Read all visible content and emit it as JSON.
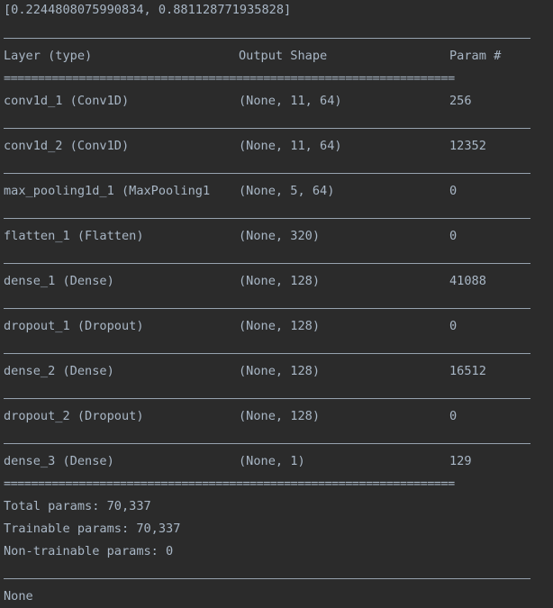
{
  "result_line": "[0.2244808075990834, 0.881128771935828]",
  "summary": {
    "headers": {
      "layer": "Layer (type)",
      "output_shape": "Output Shape",
      "param": "Param #"
    },
    "double_rule": "==================================================================",
    "rows": [
      {
        "layer": "conv1d_1 (Conv1D)",
        "shape": "(None, 11, 64)",
        "param": "256"
      },
      {
        "layer": "conv1d_2 (Conv1D)",
        "shape": "(None, 11, 64)",
        "param": "12352"
      },
      {
        "layer": "max_pooling1d_1 (MaxPooling1",
        "shape": "(None, 5, 64)",
        "param": "0"
      },
      {
        "layer": "flatten_1 (Flatten)",
        "shape": "(None, 320)",
        "param": "0"
      },
      {
        "layer": "dense_1 (Dense)",
        "shape": "(None, 128)",
        "param": "41088"
      },
      {
        "layer": "dropout_1 (Dropout)",
        "shape": "(None, 128)",
        "param": "0"
      },
      {
        "layer": "dense_2 (Dense)",
        "shape": "(None, 128)",
        "param": "16512"
      },
      {
        "layer": "dropout_2 (Dropout)",
        "shape": "(None, 128)",
        "param": "0"
      },
      {
        "layer": "dense_3 (Dense)",
        "shape": "(None, 1)",
        "param": "129"
      }
    ],
    "total_params": "Total params: 70,337",
    "trainable_params": "Trainable params: 70,337",
    "non_trainable_params": "Non-trainable params: 0"
  },
  "final_output": "None"
}
